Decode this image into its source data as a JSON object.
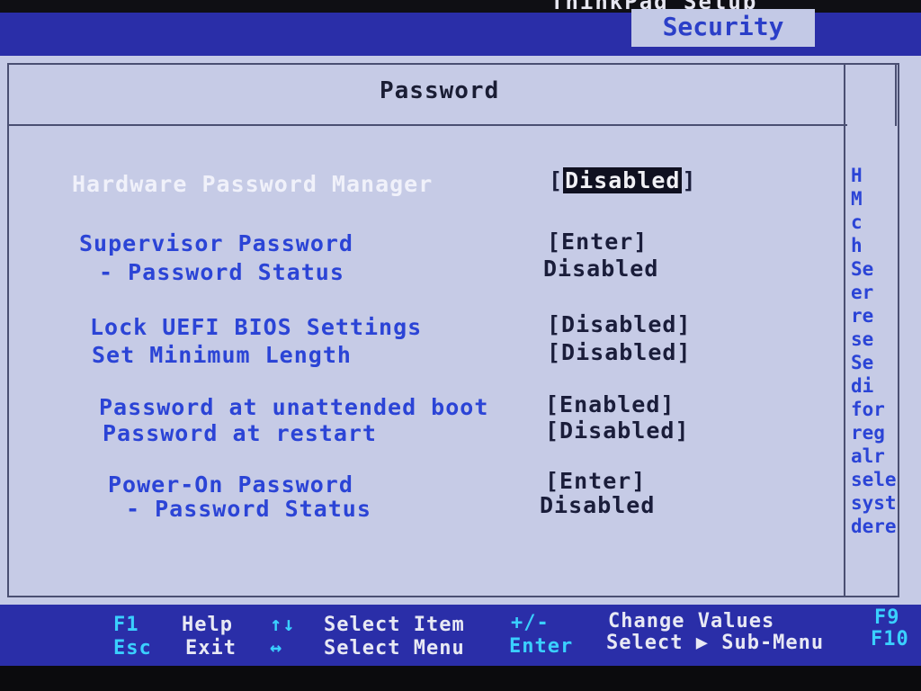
{
  "app": {
    "title": "ThinkPad Setup",
    "active_tab": "Security"
  },
  "section": {
    "title": "Password"
  },
  "rows": [
    {
      "label": "Hardware Password Manager",
      "value": "Disabled",
      "value_text": "[Disabled]",
      "selected": true
    },
    {
      "label": "Supervisor Password",
      "value_text": "[Enter]"
    },
    {
      "label": "- Password Status",
      "value_text": "Disabled"
    },
    {
      "label": "Lock UEFI BIOS Settings",
      "value_text": "[Disabled]"
    },
    {
      "label": "Set Minimum Length",
      "value_text": "[Disabled]"
    },
    {
      "label": "Password at unattended boot",
      "value_text": "[Enabled]"
    },
    {
      "label": "Password at restart",
      "value_text": "[Disabled]"
    },
    {
      "label": "Power-On Password",
      "value_text": "[Enter]"
    },
    {
      "label": "- Password Status",
      "value_text": "Disabled"
    }
  ],
  "help_text": [
    "H",
    "M",
    "c",
    "h",
    "Se",
    "er",
    "re",
    "se",
    "Se",
    "di",
    "for",
    "reg",
    "alr",
    "sele",
    "syst",
    "dere"
  ],
  "footer": {
    "keys": [
      {
        "key": "F1",
        "desc": "Help"
      },
      {
        "key": "Esc",
        "desc": "Exit"
      },
      {
        "key": "↑↓",
        "desc": "Select Item"
      },
      {
        "key": "↔",
        "desc": "Select Menu"
      },
      {
        "key": "+/-",
        "desc": "Change Values"
      },
      {
        "key": "Enter",
        "desc": "Select ▶ Sub-Menu"
      },
      {
        "key": "F9",
        "desc": ""
      },
      {
        "key": "F10",
        "desc": ""
      }
    ]
  },
  "colors": {
    "background": "#c6cbe6",
    "label": "#2b44d6",
    "highlighted_label": "#f0f1fa",
    "value": "#1a1d3a",
    "bar": "#2a2ea8",
    "footer_key": "#3ad0ff"
  }
}
